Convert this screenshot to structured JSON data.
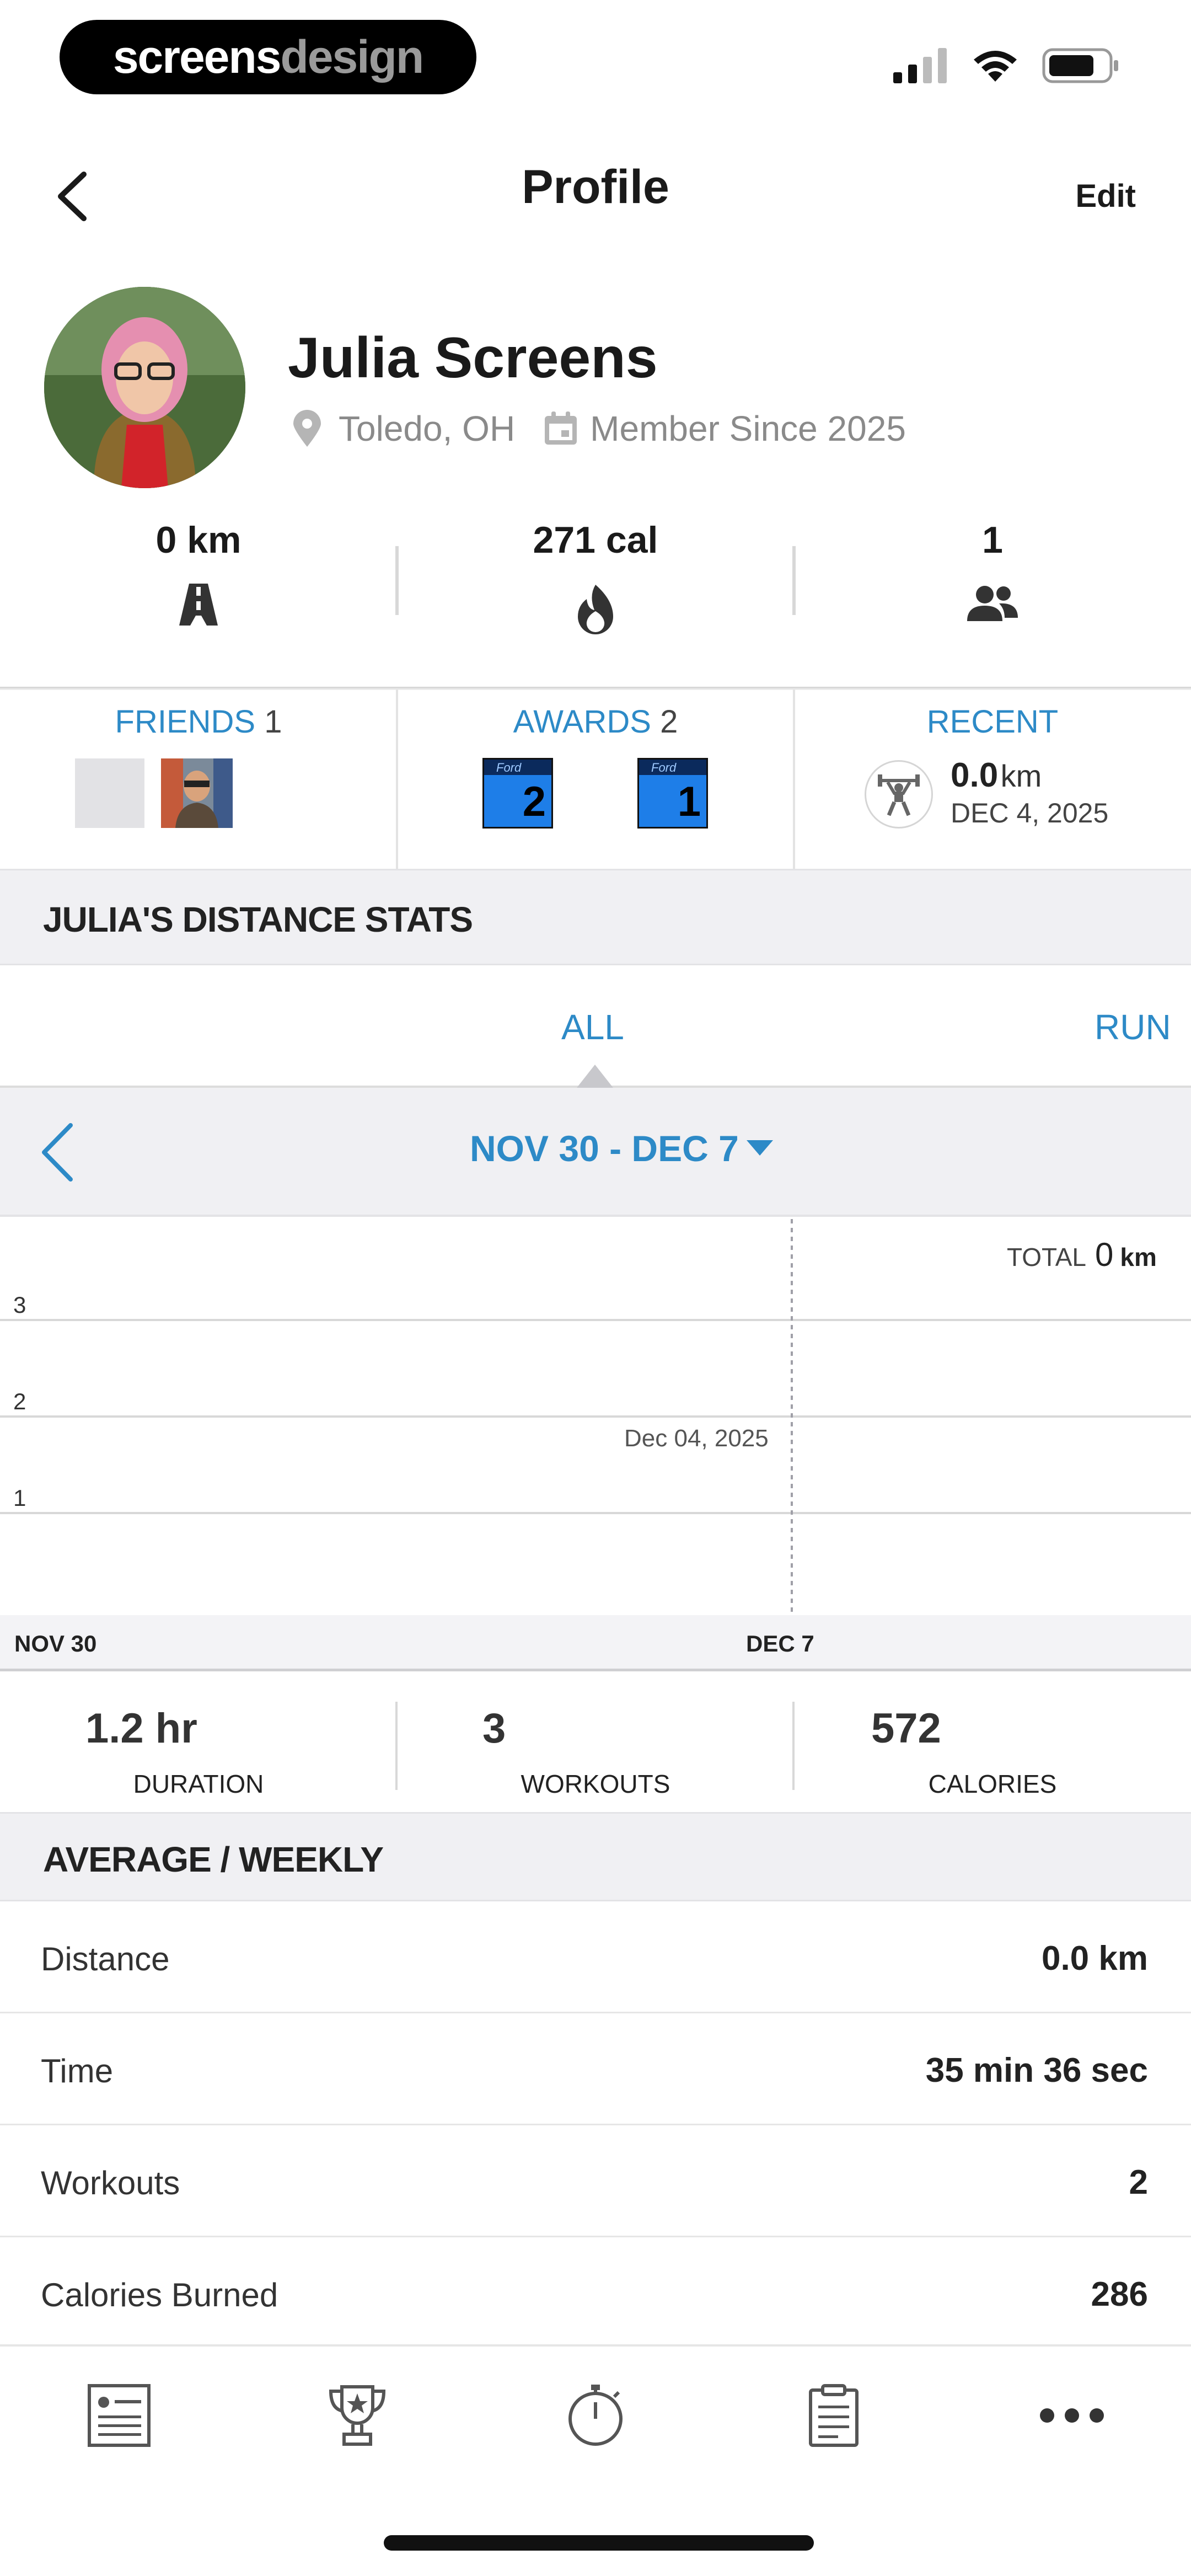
{
  "status_bar": {
    "brand_left": "screens",
    "brand_right": "design"
  },
  "header": {
    "title": "Profile",
    "edit_label": "Edit"
  },
  "profile": {
    "name": "Julia Screens",
    "location": "Toledo, OH",
    "member_since": "Member Since 2025"
  },
  "stats": [
    {
      "value": "0 km",
      "icon": "road-icon"
    },
    {
      "value": "271 cal",
      "icon": "flame-icon"
    },
    {
      "value": "1",
      "icon": "people-icon"
    }
  ],
  "panels": {
    "friends": {
      "label": "FRIENDS",
      "count": "1"
    },
    "awards": {
      "label": "AWARDS",
      "count": "2",
      "badges": [
        "2",
        "1"
      ],
      "badge_brand": "Ford"
    },
    "recent": {
      "label": "RECENT",
      "value": "0.0",
      "unit": "km",
      "date": "DEC 4, 2025"
    }
  },
  "distance_section": {
    "title": "JULIA'S DISTANCE STATS"
  },
  "tabs": {
    "all": "ALL",
    "run": "RUN"
  },
  "date_range": {
    "label": "NOV 30 - DEC 7"
  },
  "chart_data": {
    "type": "line",
    "total_label": "TOTAL",
    "total_value": "0",
    "total_unit": "km",
    "y_ticks": [
      "3",
      "2",
      "1"
    ],
    "ylim": [
      0,
      4
    ],
    "x_start_label": "NOV 30",
    "x_end_label": "DEC 7",
    "marker_label": "Dec 04, 2025",
    "x": [
      "NOV 30",
      "DEC 7"
    ],
    "values": [
      0,
      0
    ]
  },
  "summary": [
    {
      "value": "1.2 hr",
      "label": "DURATION"
    },
    {
      "value": "3",
      "label": "WORKOUTS"
    },
    {
      "value": "572",
      "label": "CALORIES"
    }
  ],
  "average_section": {
    "title": "AVERAGE / WEEKLY"
  },
  "averages": [
    {
      "label": "Distance",
      "value": "0.0 km"
    },
    {
      "label": "Time",
      "value": "35 min 36 sec"
    },
    {
      "label": "Workouts",
      "value": "2"
    },
    {
      "label": "Calories Burned",
      "value": "286"
    }
  ],
  "colors": {
    "accent": "#2d8ac7",
    "badge_blue": "#1e7ee8"
  }
}
